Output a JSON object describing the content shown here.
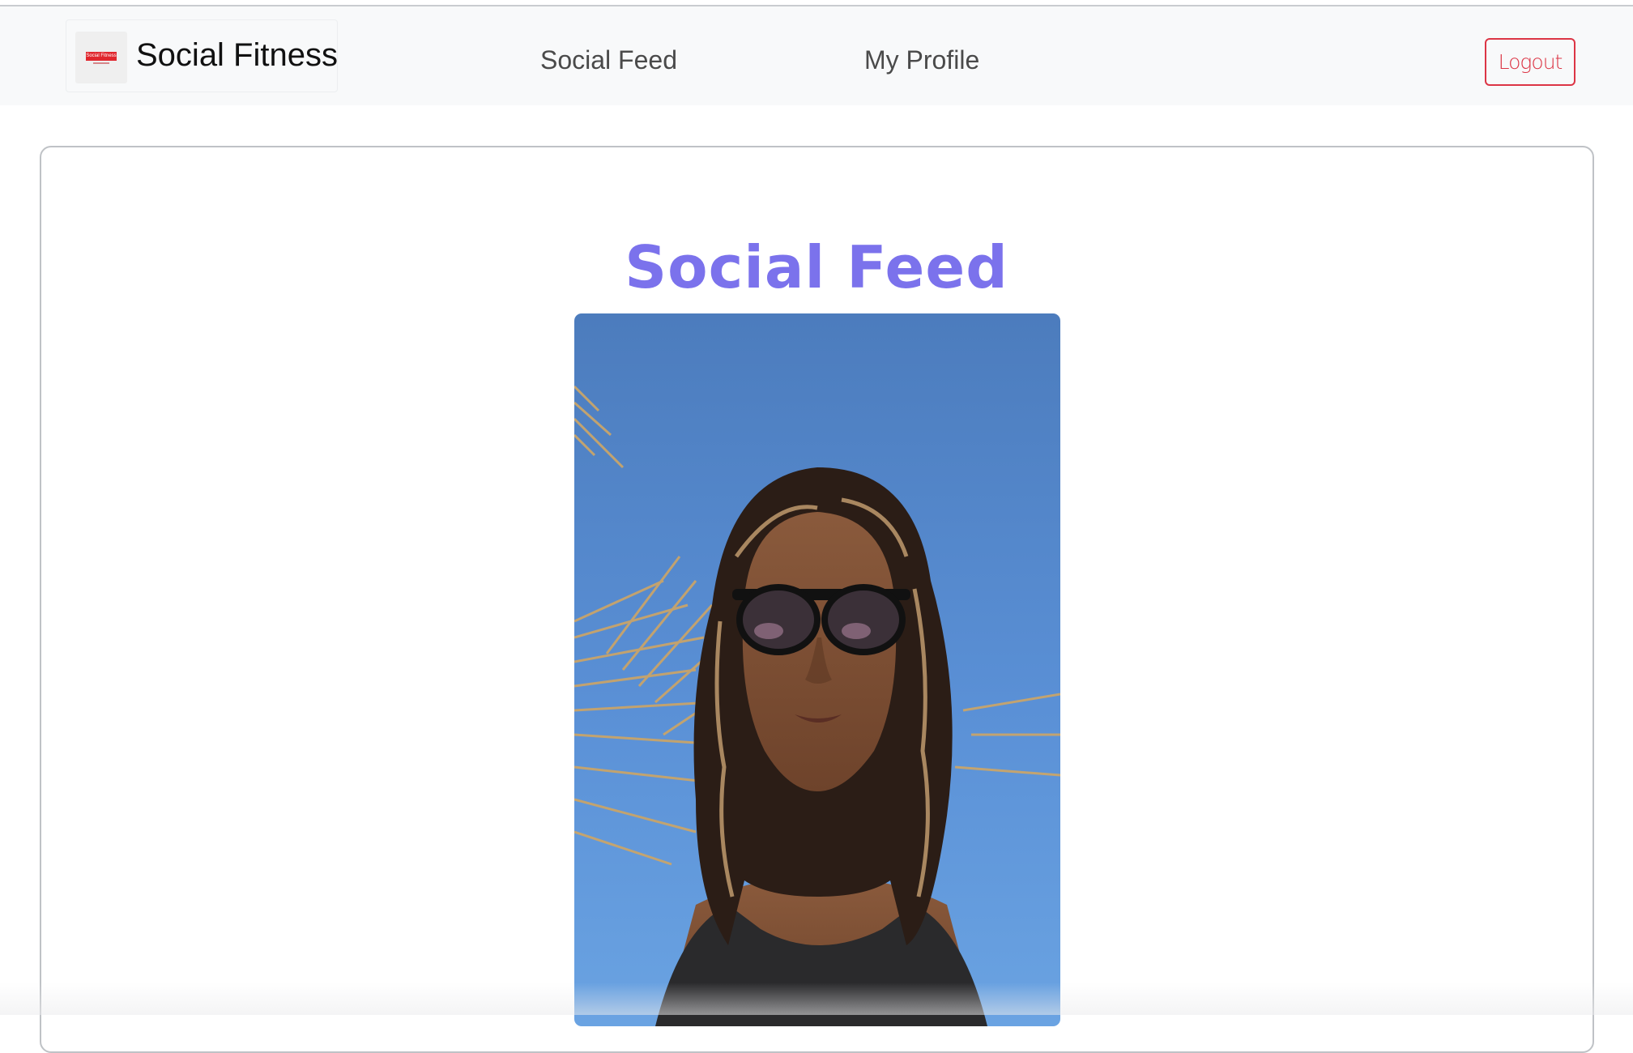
{
  "navbar": {
    "brand": {
      "name": "Social Fitness",
      "logo_text": "Social Fitness"
    },
    "links": [
      {
        "label": "Social Feed"
      },
      {
        "label": "My Profile"
      }
    ],
    "logout_label": "Logout"
  },
  "feed": {
    "title": "Social Feed",
    "posts": [
      {
        "image_icon": "user-selfie-photo"
      }
    ]
  },
  "colors": {
    "title": "#7b72ec",
    "logout": "#dc3545",
    "navbar_bg": "#f8f9fa"
  }
}
